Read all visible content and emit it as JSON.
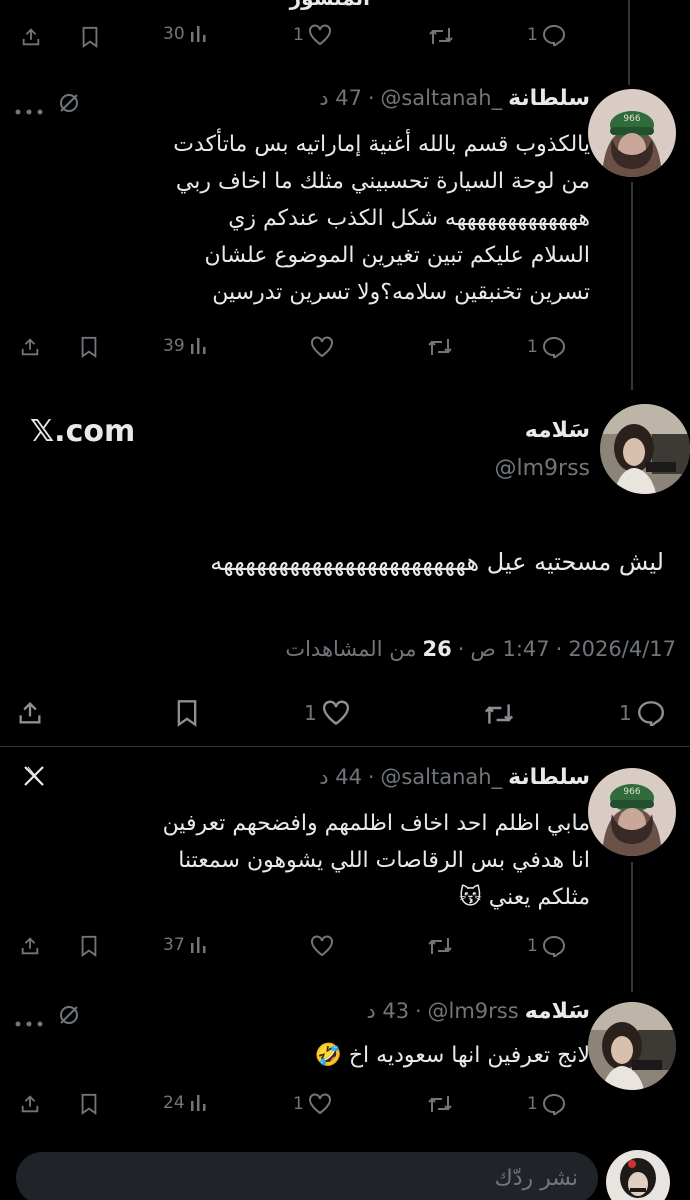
{
  "top_partial": {
    "cut_text": "المنشور",
    "views": "30",
    "likes": "1",
    "replies": "1"
  },
  "tweet1": {
    "name": "سلطانة",
    "handle": "@saltanah_",
    "time": "47 د",
    "body_lines": [
      "يالكذوب قسم بالله أغنية إماراتيه بس ماتأكدت",
      "من لوحة السيارة تحسبيني مثلك ما اخاف ربي",
      "هههههههههههههه شكل الكذب عندكم زي",
      "السلام عليكم تبين تغيرين الموضوع علشان",
      "تسرين تخنبقين سلامه؟ولا تسرين تدرسين"
    ],
    "views": "39",
    "likes": "",
    "replies": "1"
  },
  "main_tweet": {
    "name": "سَلامه",
    "handle": "@lm9rss",
    "source": "𝕏.com",
    "body": "ليش مسحتيه عيل هههههههههههههههههههههههه",
    "date": "2026/4/17",
    "time": "1:47 ص",
    "views_count": "26",
    "views_label": "من المشاهدات",
    "likes": "1",
    "replies": "1"
  },
  "tweet2": {
    "name": "سلطانة",
    "handle": "@saltanah_",
    "time": "44 د",
    "body_lines": [
      "مابي اظلم احد اخاف اظلمهم وافضحهم تعرفين",
      "انا هدفي بس الرقاصات اللي يشوهون سمعتنا",
      "مثلكم يعني 😽"
    ],
    "views": "37",
    "likes": "",
    "replies": "1"
  },
  "tweet3": {
    "name": "سَلامه",
    "handle": "@lm9rss",
    "time": "43 د",
    "body_lines": [
      "لانج تعرفين انها سعوديه اخ 🤣"
    ],
    "views": "24",
    "likes": "1",
    "replies": "1"
  },
  "reply_box": {
    "placeholder": "نشر ردّك"
  },
  "colors": {
    "background": "#000000",
    "text": "#e7e9ea",
    "muted": "#71767b",
    "divider": "#2f3336",
    "avatar_cap": "#2f6b3d"
  }
}
